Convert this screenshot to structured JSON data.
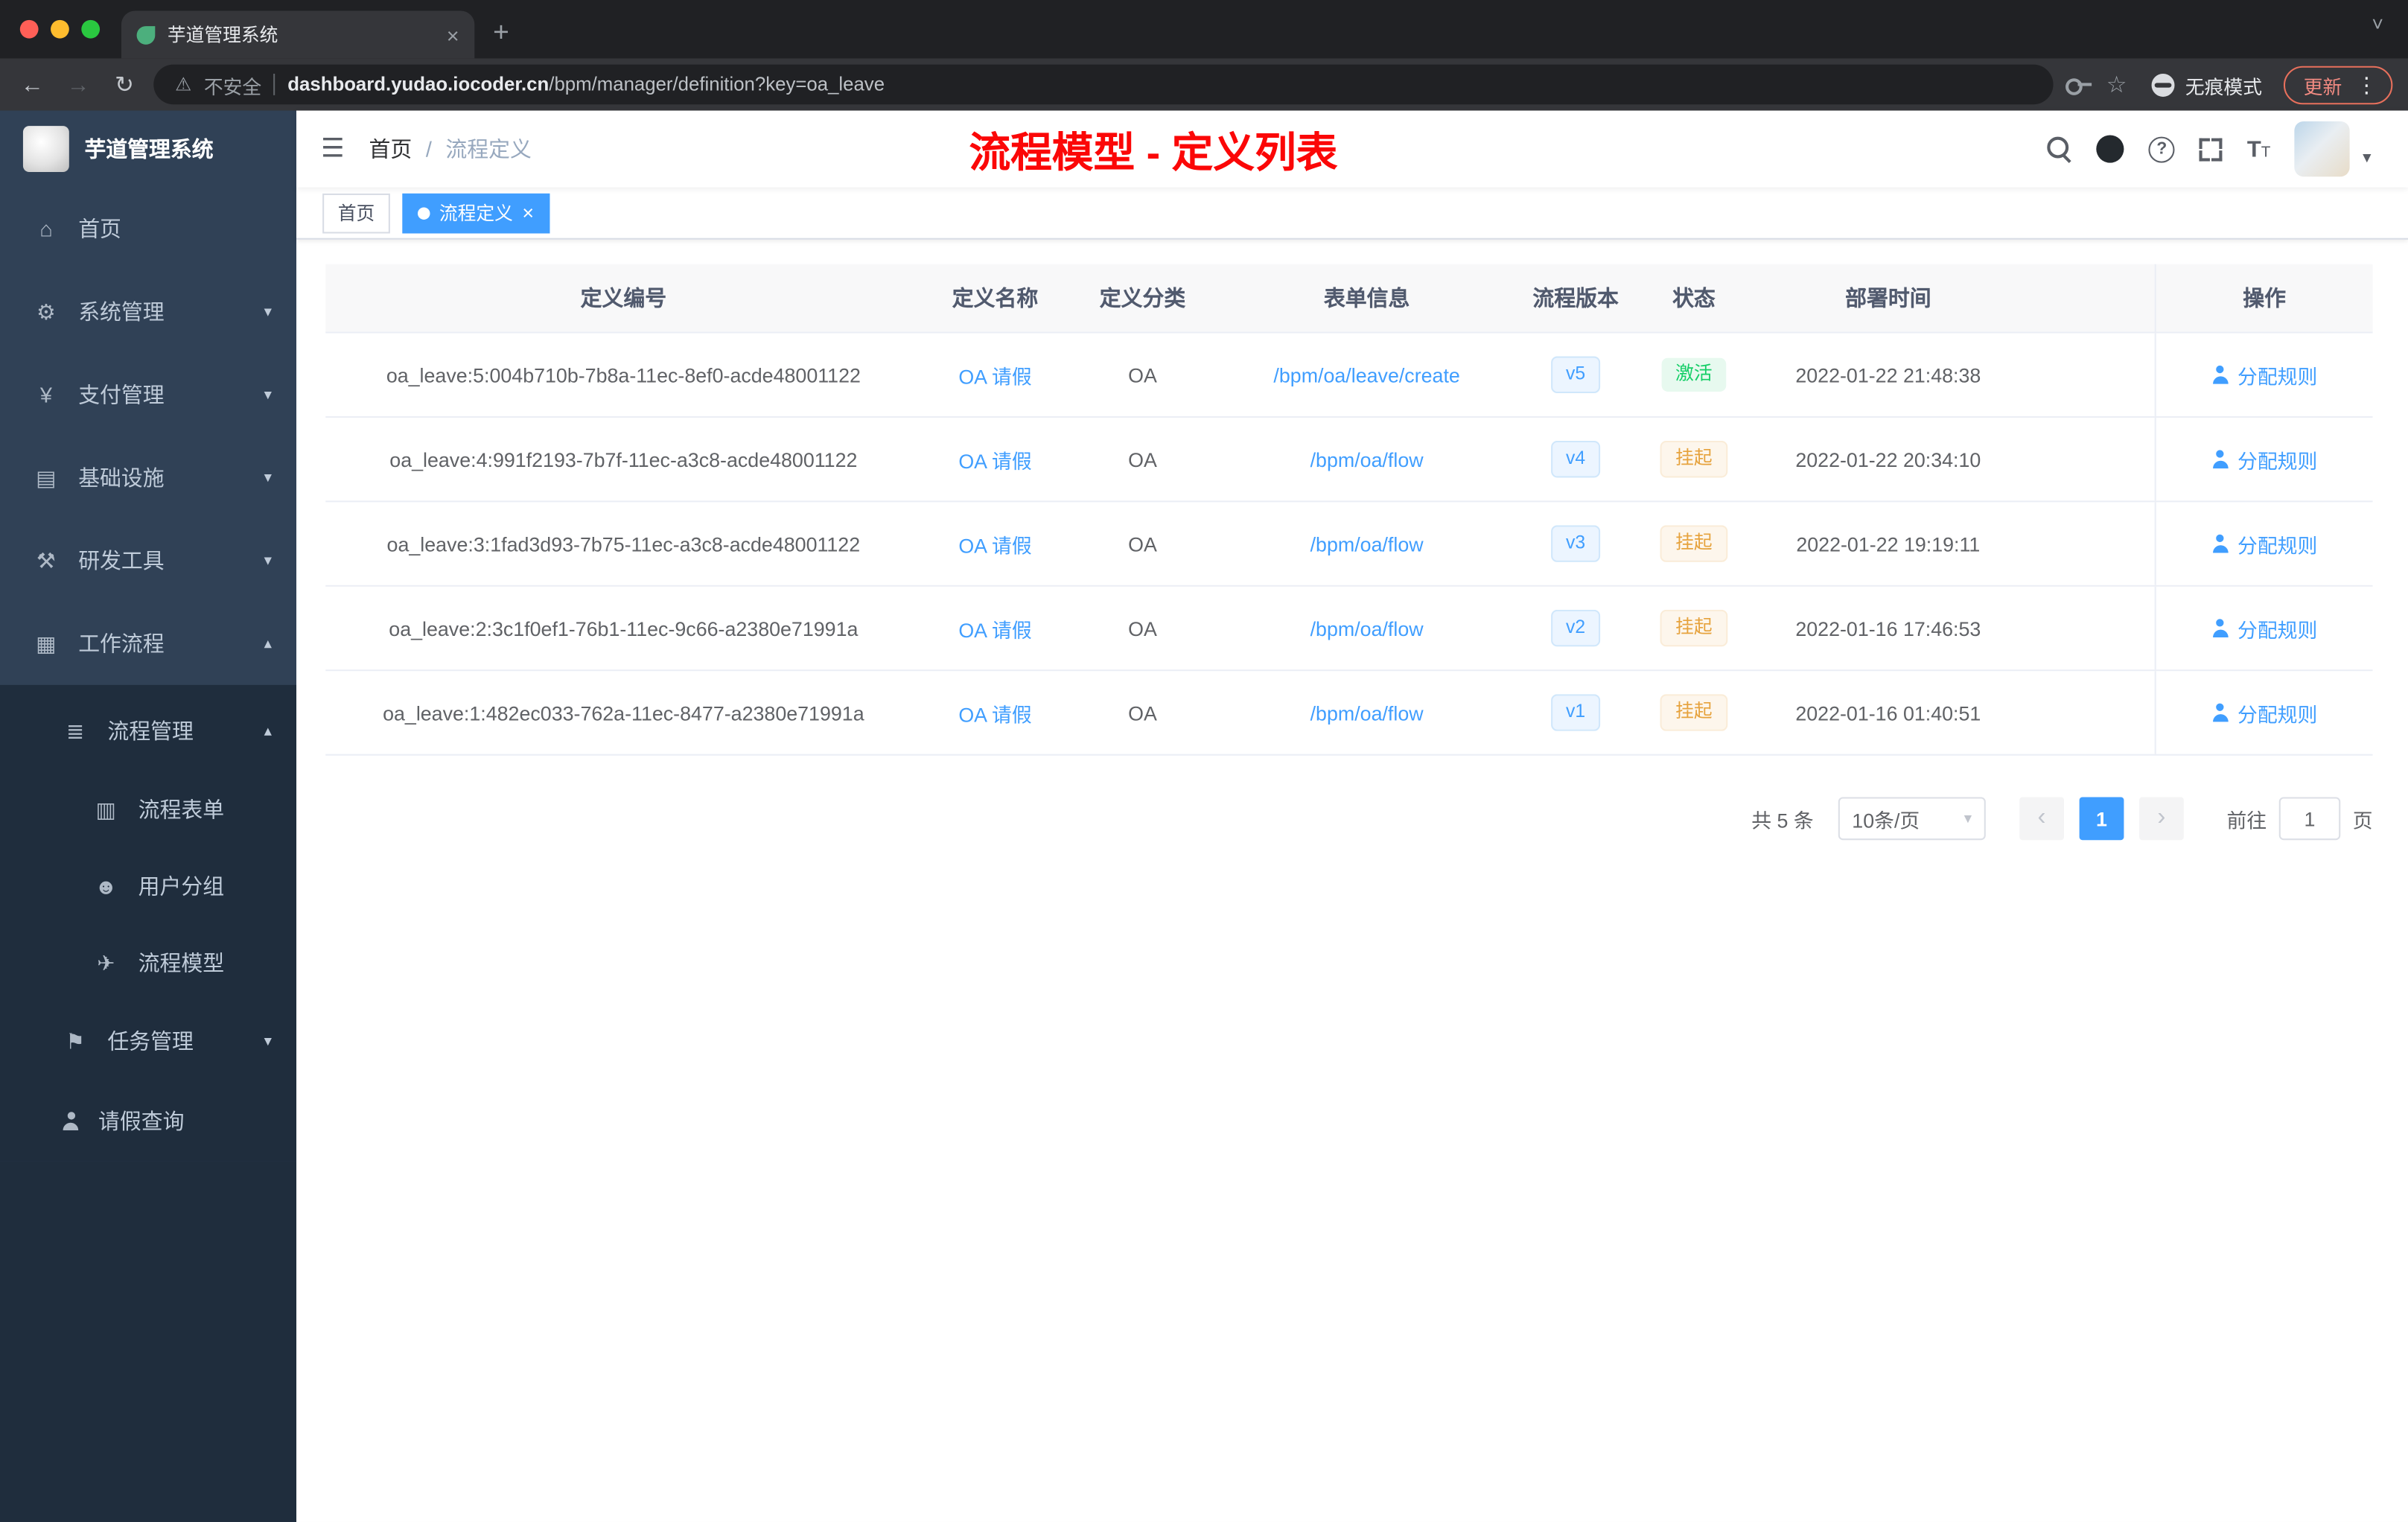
{
  "icons": {
    "close": "×",
    "plus": "+",
    "back": "←",
    "forward": "→",
    "reload": "↻",
    "warning": "⚠",
    "star": "☆",
    "dots": "⋮",
    "question": "?",
    "hamburger": "☰",
    "chevron_down": "▾",
    "chevron_up": "▴",
    "tab_chevron": "˅",
    "prev": "‹",
    "next": "›",
    "text_size": "T"
  },
  "browser": {
    "tab_title": "芋道管理系统",
    "security_label": "不安全",
    "url_host": "dashboard.yudao.iocoder.cn",
    "url_path": "/bpm/manager/definition?key=oa_leave",
    "incognito_label": "无痕模式",
    "update_label": "更新"
  },
  "sidebar": {
    "logo_title": "芋道管理系统",
    "items": [
      {
        "key": "home",
        "label": "首页",
        "icon": "home-icon",
        "glyph": "⌂",
        "level": 1,
        "arrow": "",
        "sub": false
      },
      {
        "key": "system",
        "label": "系统管理",
        "icon": "gear-icon",
        "glyph": "⚙",
        "level": 1,
        "arrow": "down",
        "sub": false
      },
      {
        "key": "payment",
        "label": "支付管理",
        "icon": "yen-icon",
        "glyph": "¥",
        "level": 1,
        "arrow": "down",
        "sub": false
      },
      {
        "key": "infrastructure",
        "label": "基础设施",
        "icon": "infrastructure-icon",
        "glyph": "▤",
        "level": 1,
        "arrow": "down",
        "sub": false
      },
      {
        "key": "devtools",
        "label": "研发工具",
        "icon": "tools-icon",
        "glyph": "⚒",
        "level": 1,
        "arrow": "down",
        "sub": false
      },
      {
        "key": "workflow",
        "label": "工作流程",
        "icon": "workflow-icon",
        "glyph": "▦",
        "level": 1,
        "arrow": "up",
        "sub": false
      },
      {
        "key": "process-manage",
        "label": "流程管理",
        "icon": "process-list-icon",
        "glyph": "≣",
        "level": 2,
        "arrow": "up",
        "sub": true
      },
      {
        "key": "process-form",
        "label": "流程表单",
        "icon": "form-icon",
        "glyph": "▥",
        "level": 3,
        "arrow": "",
        "sub": true
      },
      {
        "key": "user-group",
        "label": "用户分组",
        "icon": "user-group-icon",
        "glyph": "☻",
        "level": 3,
        "arrow": "",
        "sub": true
      },
      {
        "key": "process-model",
        "label": "流程模型",
        "icon": "paper-plane-icon",
        "glyph": "✈",
        "level": 3,
        "arrow": "",
        "sub": true
      },
      {
        "key": "task-manage",
        "label": "任务管理",
        "icon": "flag-icon",
        "glyph": "⚑",
        "level": 2,
        "arrow": "down",
        "sub": true
      },
      {
        "key": "leave-query",
        "label": "请假查询",
        "icon": "person-icon",
        "glyph": "person",
        "level": 2,
        "arrow": "",
        "sub": true
      }
    ]
  },
  "navbar": {
    "breadcrumb_home": "首页",
    "breadcrumb_separator": "/",
    "breadcrumb_current": "流程定义",
    "annotation": "流程模型 - 定义列表"
  },
  "tags": [
    {
      "label": "首页",
      "active": false,
      "closable": false
    },
    {
      "label": "流程定义",
      "active": true,
      "closable": true
    }
  ],
  "table": {
    "columns": [
      "定义编号",
      "定义名称",
      "定义分类",
      "表单信息",
      "流程版本",
      "状态",
      "部署时间",
      "操作"
    ],
    "action_label": "分配规则",
    "rows": [
      {
        "id": "oa_leave:5:004b710b-7b8a-11ec-8ef0-acde48001122",
        "name": "OA 请假",
        "category": "OA",
        "form": "/bpm/oa/leave/create",
        "version": "v5",
        "status": "激活",
        "status_type": "success",
        "time": "2022-01-22 21:48:38"
      },
      {
        "id": "oa_leave:4:991f2193-7b7f-11ec-a3c8-acde48001122",
        "name": "OA 请假",
        "category": "OA",
        "form": "/bpm/oa/flow",
        "version": "v4",
        "status": "挂起",
        "status_type": "warning",
        "time": "2022-01-22 20:34:10"
      },
      {
        "id": "oa_leave:3:1fad3d93-7b75-11ec-a3c8-acde48001122",
        "name": "OA 请假",
        "category": "OA",
        "form": "/bpm/oa/flow",
        "version": "v3",
        "status": "挂起",
        "status_type": "warning",
        "time": "2022-01-22 19:19:11"
      },
      {
        "id": "oa_leave:2:3c1f0ef1-76b1-11ec-9c66-a2380e71991a",
        "name": "OA 请假",
        "category": "OA",
        "form": "/bpm/oa/flow",
        "version": "v2",
        "status": "挂起",
        "status_type": "warning",
        "time": "2022-01-16 17:46:53"
      },
      {
        "id": "oa_leave:1:482ec033-762a-11ec-8477-a2380e71991a",
        "name": "OA 请假",
        "category": "OA",
        "form": "/bpm/oa/flow",
        "version": "v1",
        "status": "挂起",
        "status_type": "warning",
        "time": "2022-01-16 01:40:51"
      }
    ]
  },
  "pagination": {
    "total_label": "共 5 条",
    "page_size_label": "10条/页",
    "current_page": "1",
    "goto_label": "前往",
    "goto_value": "1",
    "unit_label": "页"
  }
}
